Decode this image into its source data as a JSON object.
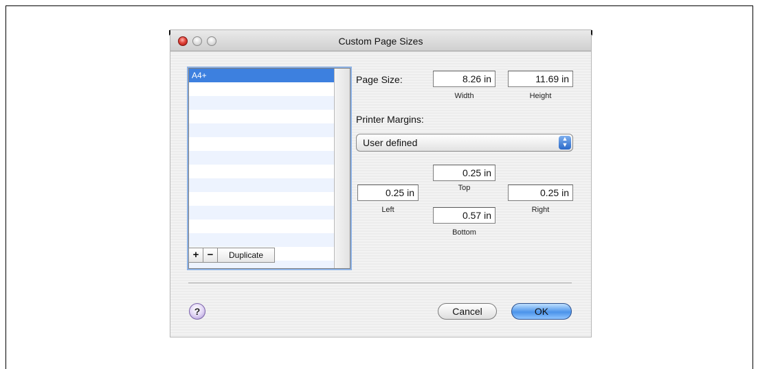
{
  "window": {
    "title": "Custom Page Sizes"
  },
  "list": {
    "items": [
      {
        "label": "A4+",
        "selected": true
      }
    ]
  },
  "list_buttons": {
    "add": "+",
    "remove": "−",
    "duplicate": "Duplicate"
  },
  "page_size": {
    "label": "Page Size:",
    "width_value": "8.26 in",
    "width_label": "Width",
    "height_value": "11.69 in",
    "height_label": "Height"
  },
  "printer_margins": {
    "label": "Printer Margins:",
    "selected": "User defined",
    "top_value": "0.25 in",
    "top_label": "Top",
    "left_value": "0.25 in",
    "left_label": "Left",
    "right_value": "0.25 in",
    "right_label": "Right",
    "bottom_value": "0.57 in",
    "bottom_label": "Bottom"
  },
  "footer": {
    "help": "?",
    "cancel": "Cancel",
    "ok": "OK"
  },
  "colors": {
    "selection": "#3d80df",
    "default_button": "#4b93ea"
  }
}
